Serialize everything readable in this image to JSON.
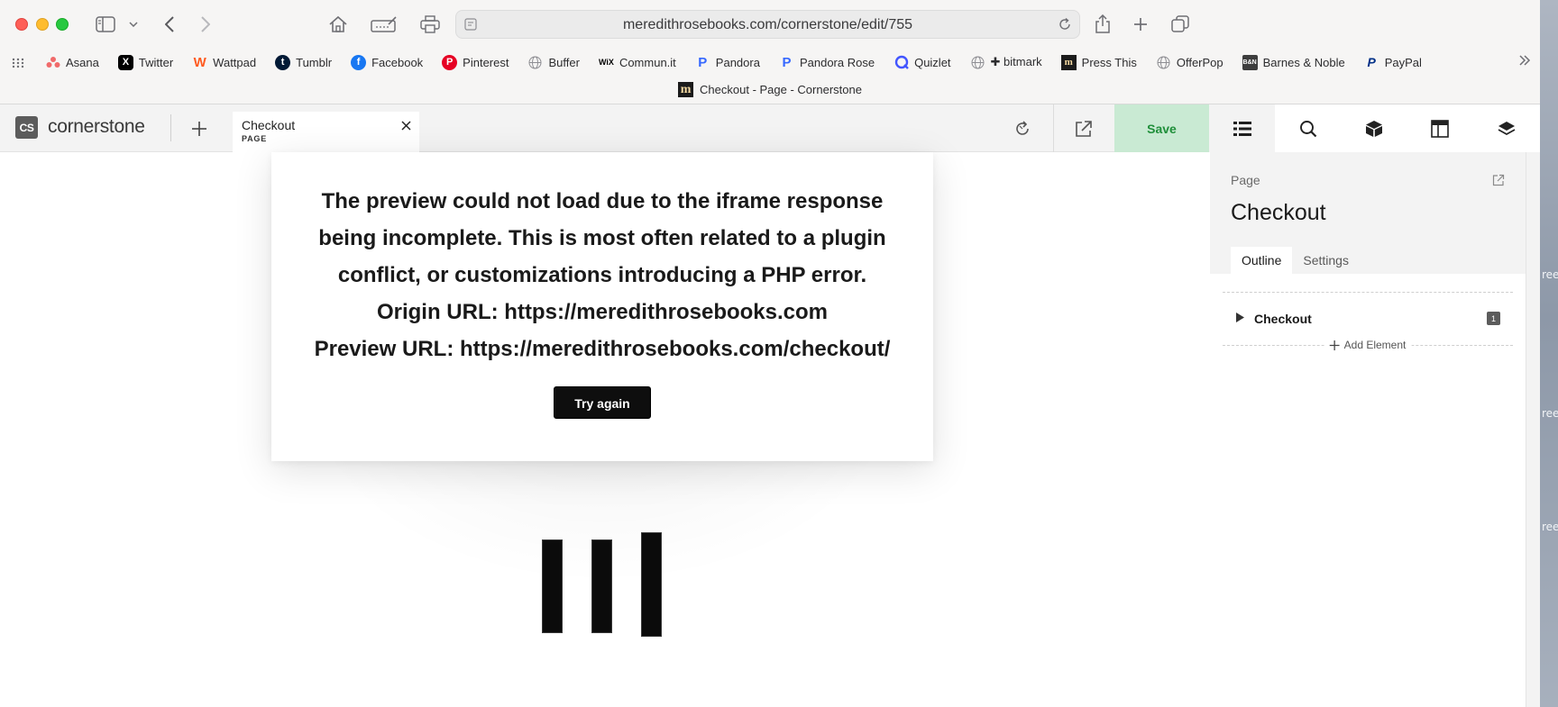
{
  "browser": {
    "url": "meredithrosebooks.com/cornerstone/edit/755",
    "window_title": "Checkout - Page - Cornerstone",
    "bookmarks": [
      {
        "label": "Asana",
        "icon": "asana-icon",
        "color": "#f06a6a"
      },
      {
        "label": "Twitter",
        "icon": "x-twitter-icon",
        "color": "#000000"
      },
      {
        "label": "Wattpad",
        "icon": "wattpad-icon",
        "color": "#ff5a1f"
      },
      {
        "label": "Tumblr",
        "icon": "tumblr-icon",
        "color": "#001935"
      },
      {
        "label": "Facebook",
        "icon": "facebook-icon",
        "color": "#1877f2"
      },
      {
        "label": "Pinterest",
        "icon": "pinterest-icon",
        "color": "#e60023"
      },
      {
        "label": "Buffer",
        "icon": "globe-icon",
        "color": "#8e8e93"
      },
      {
        "label": "Commun.it",
        "icon": "wix-icon",
        "color": "#000000"
      },
      {
        "label": "Pandora",
        "icon": "pandora-icon",
        "color": "#3668ff"
      },
      {
        "label": "Pandora Rose",
        "icon": "pandora-icon",
        "color": "#3668ff"
      },
      {
        "label": "Quizlet",
        "icon": "quizlet-icon",
        "color": "#4255ff"
      },
      {
        "label": "✚ bitmark",
        "icon": "globe-icon",
        "color": "#8e8e93"
      },
      {
        "label": "Press This",
        "icon": "press-this-icon",
        "color": "#1b1b1b"
      },
      {
        "label": "OfferPop",
        "icon": "globe-icon",
        "color": "#8e8e93"
      },
      {
        "label": "Barnes & Noble",
        "icon": "barnes-noble-icon",
        "color": "#3d3d3d"
      },
      {
        "label": "PayPal",
        "icon": "paypal-icon",
        "color": "#003087"
      }
    ]
  },
  "app": {
    "logo_badge": "CS",
    "logo_text": "cornerstone",
    "doc_tab": {
      "title": "Checkout",
      "type": "PAGE"
    },
    "save_label": "Save",
    "save_bg": "#c9ead3",
    "save_color": "#1f8f3a",
    "right_tools": [
      "outline-list-icon",
      "search-icon",
      "cube-icon",
      "layout-icon",
      "layers-icon"
    ]
  },
  "preview_error": {
    "lines": [
      "The preview could not load due to the iframe response",
      "being incomplete. This is most often related to a plugin",
      "conflict, or customizations introducing a PHP error.",
      "Origin URL: https://meredithrosebooks.com",
      "Preview URL: https://meredithrosebooks.com/checkout/"
    ],
    "button": "Try again"
  },
  "panel": {
    "label": "Page",
    "title": "Checkout",
    "tabs": [
      "Outline",
      "Settings"
    ],
    "outline_item": {
      "name": "Checkout",
      "count": "1"
    },
    "add_element": "Add Element"
  },
  "desktop_fragments": [
    "ree",
    "ree",
    "ree"
  ]
}
